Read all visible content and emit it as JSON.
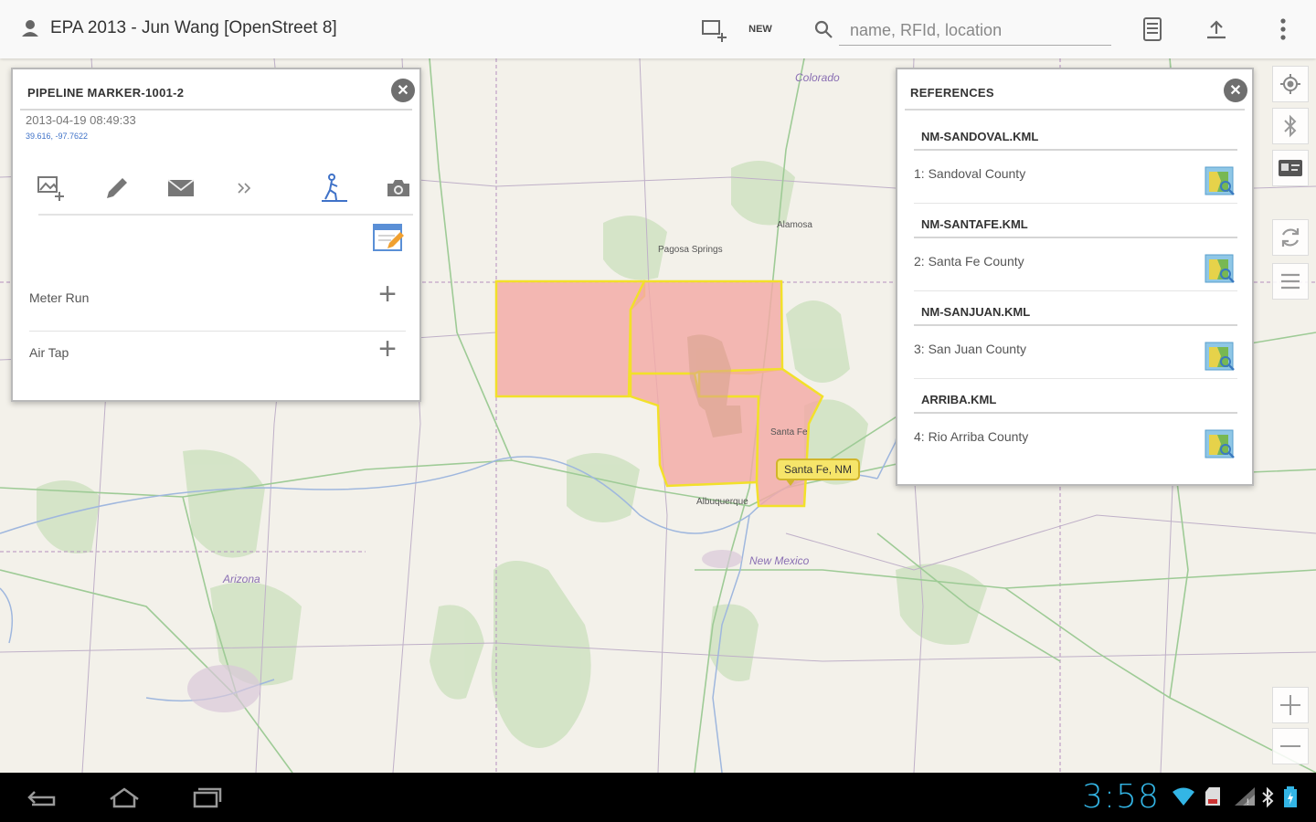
{
  "app": {
    "title": "EPA 2013 - Jun Wang [OpenStreet  8]",
    "new_label": "NEW",
    "search_placeholder": "name, RFId, location",
    "icons": [
      "user-icon",
      "new-map-icon",
      "search-icon",
      "calculator-icon",
      "upload-icon",
      "overflow-menu-icon"
    ]
  },
  "marker_panel": {
    "title": "PIPELINE MARKER-1001-2",
    "timestamp": "2013-04-19 08:49:33",
    "coordinates": "39.616, -97.7622",
    "tools": [
      "add-image-icon",
      "edit-icon",
      "mail-icon",
      "more-icon",
      "gps-walk-icon",
      "camera-icon"
    ],
    "attributes": [
      {
        "label": "Meter Run"
      },
      {
        "label": "Air Tap"
      }
    ]
  },
  "references_panel": {
    "title": "REFERENCES",
    "groups": [
      {
        "file": "NM-SANDOVAL.KML",
        "item": "1: Sandoval County"
      },
      {
        "file": "NM-SANTAFE.KML",
        "item": "2: Santa Fe County"
      },
      {
        "file": "NM-SANJUAN.KML",
        "item": "3: San Juan County"
      },
      {
        "file": "ARRIBA.KML",
        "item": "4: Rio Arriba County"
      }
    ]
  },
  "map": {
    "callout": "Santa Fe, NM",
    "labels": {
      "colorado": "Colorado",
      "new_mexico": "New Mexico",
      "arizona": "Arizona",
      "santa_fe": "Santa Fe",
      "albuquerque": "Albuquerque",
      "pagosa": "Pagosa Springs",
      "alamosa": "Alamosa"
    },
    "highlight_fill": "#f3aaa6",
    "highlight_stroke": "#f2e02a"
  },
  "map_controls": [
    "locate-icon",
    "bluetooth-icon",
    "rfid-icon",
    "refresh-icon",
    "layers-icon",
    "zoom-in-icon",
    "zoom-out-icon"
  ],
  "status_bar": {
    "time": "3:58",
    "nav": [
      "back-icon",
      "home-icon",
      "recents-icon"
    ],
    "status_icons": [
      "wifi-icon",
      "sd-card-icon",
      "signal-icon",
      "bluetooth-status-icon",
      "battery-icon"
    ]
  }
}
